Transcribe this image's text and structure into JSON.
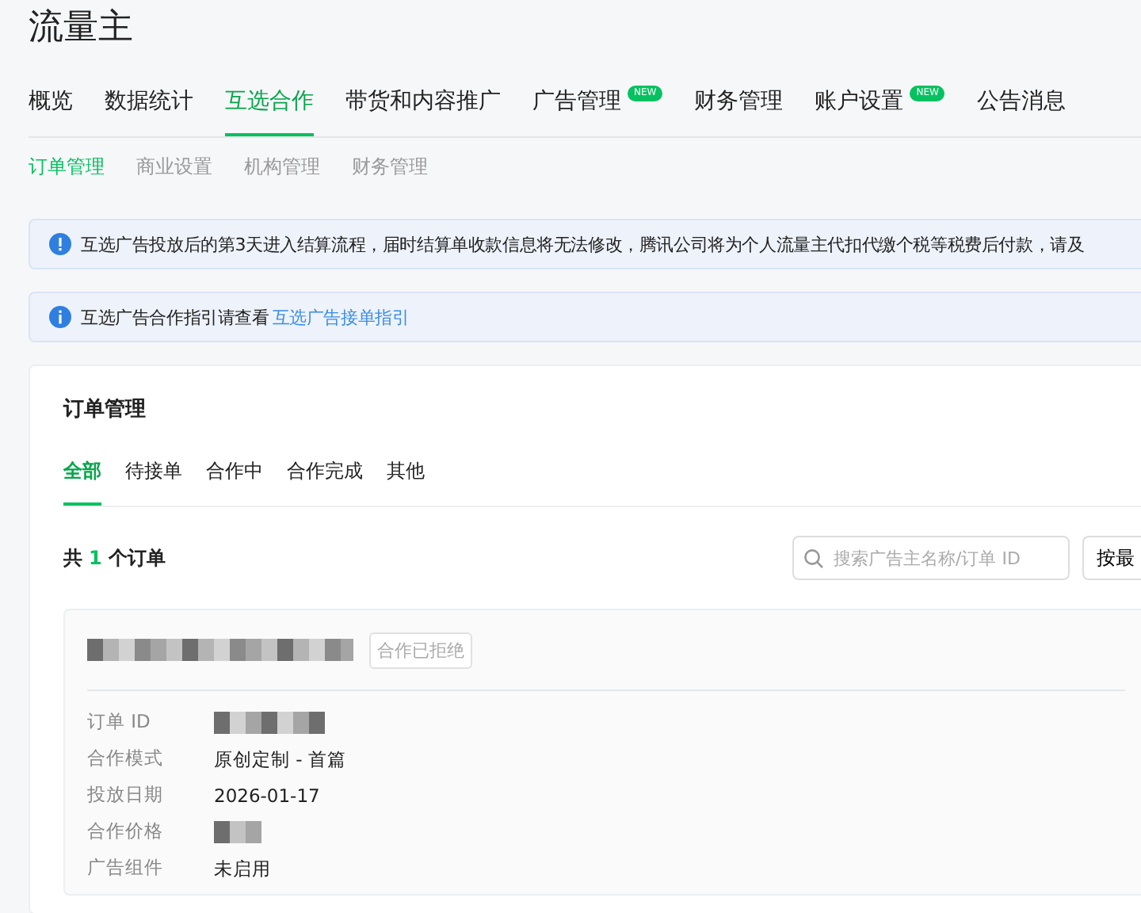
{
  "app_title": "流量主",
  "tabs": [
    {
      "label": "概览",
      "selected": false
    },
    {
      "label": "数据统计",
      "selected": false
    },
    {
      "label": "互选合作",
      "selected": true
    },
    {
      "label": "带货和内容推广",
      "selected": false
    },
    {
      "label": "广告管理",
      "selected": false,
      "badge": "NEW"
    },
    {
      "label": "财务管理",
      "selected": false
    },
    {
      "label": "账户设置",
      "selected": false,
      "badge": "NEW"
    },
    {
      "label": "公告消息",
      "selected": false
    }
  ],
  "subtabs": [
    {
      "label": "订单管理",
      "selected": true
    },
    {
      "label": "商业设置",
      "selected": false
    },
    {
      "label": "机构管理",
      "selected": false
    },
    {
      "label": "财务管理",
      "selected": false
    }
  ],
  "alerts": [
    {
      "kind": "warning",
      "text": "互选广告投放后的第3天进入结算流程，届时结算单收款信息将无法修改，腾讯公司将为个人流量主代扣代缴个税等税费后付款，请及"
    },
    {
      "kind": "info",
      "text": "互选广告合作指引请查看",
      "link": "互选广告接单指引"
    }
  ],
  "orders": {
    "title": "订单管理",
    "filters": [
      {
        "label": "全部",
        "selected": true
      },
      {
        "label": "待接单",
        "selected": false
      },
      {
        "label": "合作中",
        "selected": false
      },
      {
        "label": "合作完成",
        "selected": false
      },
      {
        "label": "其他",
        "selected": false
      }
    ],
    "count_prefix": "共",
    "count": "1",
    "count_suffix": "个订单",
    "search": {
      "placeholder": "搜索广告主名称/订单 ID"
    },
    "sort_button": "按最",
    "items": [
      {
        "status": "合作已拒绝",
        "fields": [
          {
            "label": "订单 ID"
          },
          {
            "label": "合作模式",
            "value": "原创定制 - 首篇"
          },
          {
            "label": "投放日期",
            "value": "2026-01-17"
          },
          {
            "label": "合作价格"
          },
          {
            "label": "广告组件",
            "value": "未启用"
          }
        ]
      }
    ]
  }
}
